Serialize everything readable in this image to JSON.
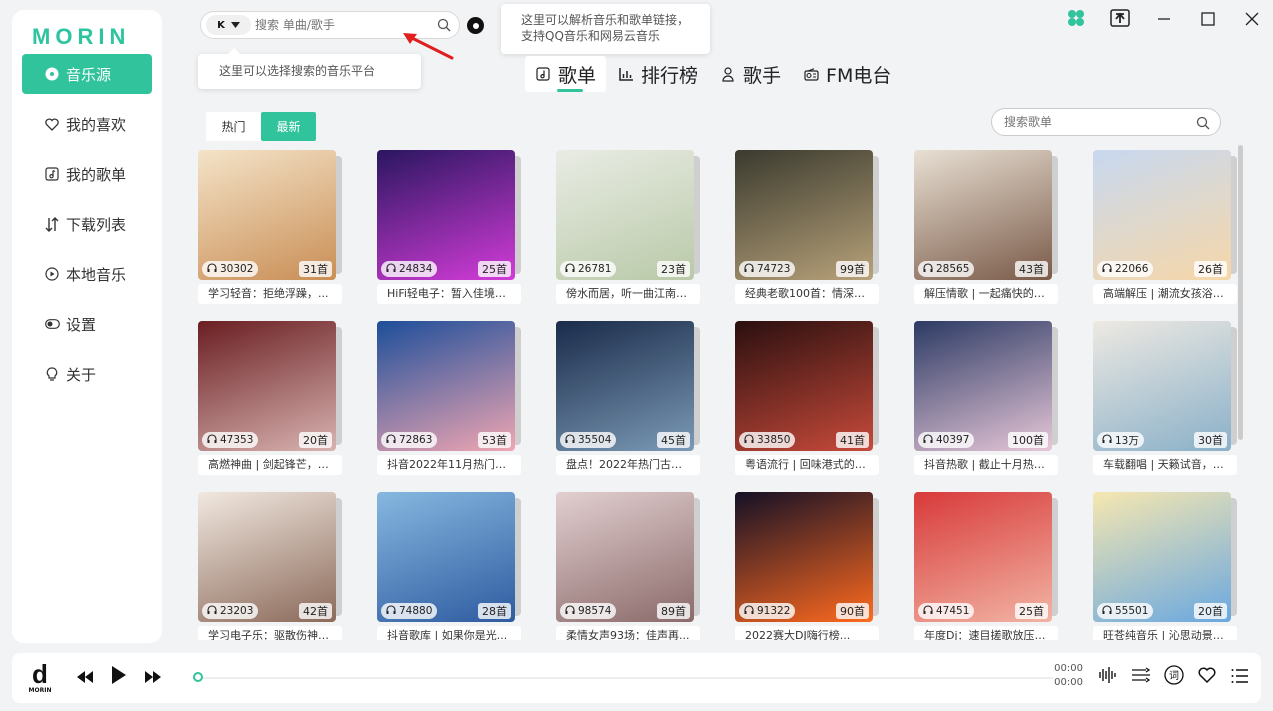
{
  "app": {
    "logo": "MORIN"
  },
  "sidebar": {
    "items": [
      {
        "label": "音乐源",
        "icon": "disc-icon"
      },
      {
        "label": "我的喜欢",
        "icon": "heart-icon"
      },
      {
        "label": "我的歌单",
        "icon": "playlist-icon"
      },
      {
        "label": "下载列表",
        "icon": "download-sort-icon"
      },
      {
        "label": "本地音乐",
        "icon": "play-circle-icon"
      },
      {
        "label": "设置",
        "icon": "toggle-icon"
      },
      {
        "label": "关于",
        "icon": "lightbulb-icon"
      }
    ]
  },
  "search": {
    "platform": "K",
    "placeholder": "搜索 单曲/歌手"
  },
  "tips": {
    "parse_line1": "这里可以解析音乐和歌单链接，",
    "parse_line2": "支持QQ音乐和网易云音乐",
    "platform": "这里可以选择搜索的音乐平台"
  },
  "tabs": [
    {
      "label": "歌单",
      "icon": "music-note-icon"
    },
    {
      "label": "排行榜",
      "icon": "bar-chart-icon"
    },
    {
      "label": "歌手",
      "icon": "singer-icon"
    },
    {
      "label": "FM电台",
      "icon": "radio-icon"
    }
  ],
  "toggle": {
    "hot": "热门",
    "latest": "最新"
  },
  "playlist_search": {
    "placeholder": "搜索歌单"
  },
  "playlists": [
    {
      "plays": "30302",
      "count": "31首",
      "title": "学习轻音：拒绝浮躁，..."
    },
    {
      "plays": "24834",
      "count": "25首",
      "title": "HiFi轻电子：暂入佳境，..."
    },
    {
      "plays": "26781",
      "count": "23首",
      "title": "傍水而居，听一曲江南风..."
    },
    {
      "plays": "74723",
      "count": "99首",
      "title": "经典老歌100首：情深缘..."
    },
    {
      "plays": "28565",
      "count": "43首",
      "title": "解压情歌 | 一起痛快的哭..."
    },
    {
      "plays": "22066",
      "count": "26首",
      "title": "高端解压 | 潮流女孩浴室..."
    },
    {
      "plays": "47353",
      "count": "20首",
      "title": "高燃神曲 | 剑起锋芒，厮..."
    },
    {
      "plays": "72863",
      "count": "53首",
      "title": "抖音2022年11月热门BGM"
    },
    {
      "plays": "35504",
      "count": "45首",
      "title": "盘点！2022年热门古风..."
    },
    {
      "plays": "33850",
      "count": "41首",
      "title": "粤语流行 | 回味港式的经..."
    },
    {
      "plays": "40397",
      "count": "100首",
      "title": "抖音热歌 | 截止十月热门..."
    },
    {
      "plays": "13万",
      "count": "30首",
      "title": "车载翻唱 | 天籁试音，回..."
    },
    {
      "plays": "23203",
      "count": "42首",
      "title": "学习电子乐：驱散伤神外..."
    },
    {
      "plays": "74880",
      "count": "28首",
      "title": "抖音歌库 | 如果你是光..."
    },
    {
      "plays": "98574",
      "count": "89首",
      "title": "柔情女声93场：佳声再..."
    },
    {
      "plays": "91322",
      "count": "90首",
      "title": "2022赛大DJ嗨行榜..."
    },
    {
      "plays": "47451",
      "count": "25首",
      "title": "年度Dj：速目搓歌放压力..."
    },
    {
      "plays": "55501",
      "count": "20首",
      "title": "旺苍纯音乐 | 沁思动景慧..."
    }
  ],
  "player": {
    "logo_letter": "d",
    "logo_text": "MORIN",
    "time_current": "00:00",
    "time_total": "00:00",
    "progress": 0
  },
  "colors": {
    "accent": "#31c39c"
  }
}
